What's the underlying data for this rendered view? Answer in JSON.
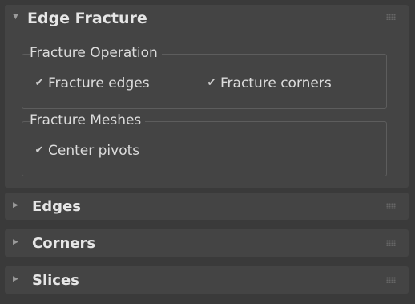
{
  "rollouts": [
    {
      "title": "Edge Fracture",
      "expanded": true,
      "arrow": "▼",
      "groups": [
        {
          "label": "Fracture Operation",
          "options": [
            {
              "label": "Fracture edges",
              "checked": true
            },
            {
              "label": "Fracture corners",
              "checked": true
            }
          ]
        },
        {
          "label": "Fracture Meshes",
          "options": [
            {
              "label": "Center pivots",
              "checked": true
            }
          ]
        }
      ]
    },
    {
      "title": "Edges",
      "expanded": false,
      "arrow": "▶"
    },
    {
      "title": "Corners",
      "expanded": false,
      "arrow": "▶"
    },
    {
      "title": "Slices",
      "expanded": false,
      "arrow": "▶"
    }
  ],
  "icons": {
    "checkmark": "✔",
    "grip": "grip-dots-icon"
  }
}
